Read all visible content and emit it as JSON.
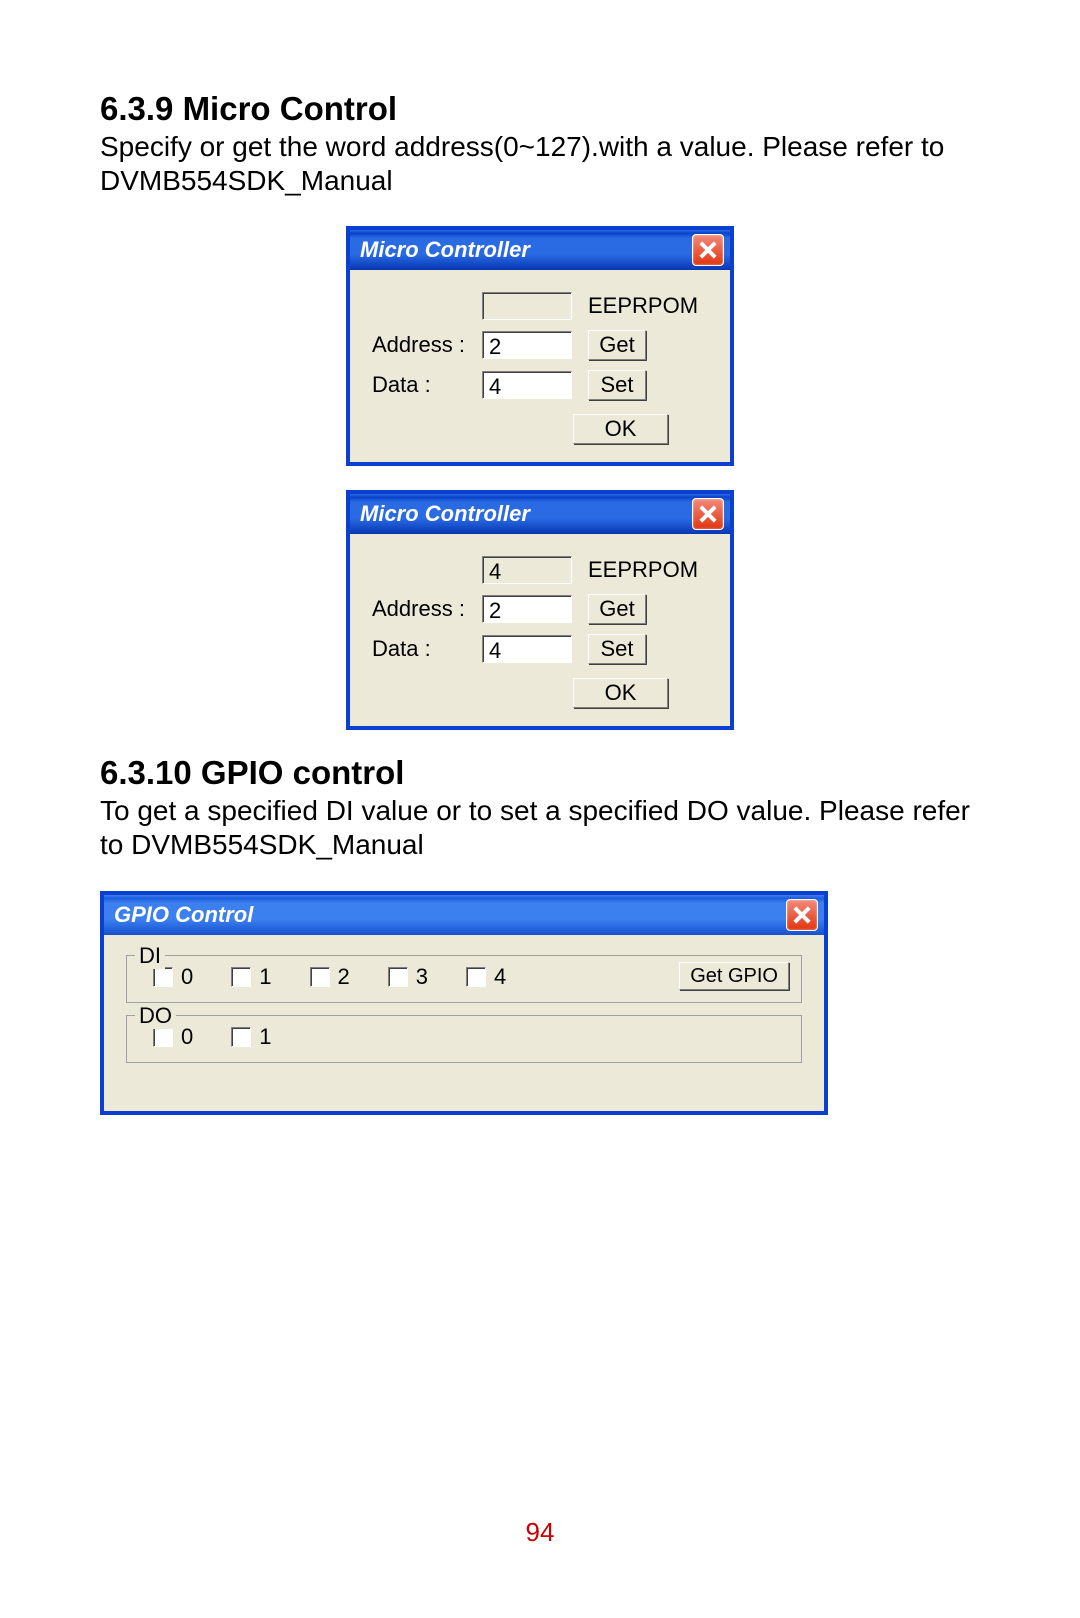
{
  "section1": {
    "heading": "6.3.9 Micro Control",
    "para": "Specify or get the word address(0~127).with a value. Please refer to DVMB554SDK_Manual"
  },
  "dialogA": {
    "title": "Micro Controller",
    "topvalue": "",
    "eeprom": "EEPRPOM",
    "addr_label": "Address :",
    "addr_value": "2",
    "get": "Get",
    "data_label": "Data :",
    "data_value": "4",
    "set": "Set",
    "ok": "OK"
  },
  "dialogB": {
    "title": "Micro Controller",
    "topvalue": "4",
    "eeprom": "EEPRPOM",
    "addr_label": "Address :",
    "addr_value": "2",
    "get": "Get",
    "data_label": "Data :",
    "data_value": "4",
    "set": "Set",
    "ok": "OK"
  },
  "section2": {
    "heading": "6.3.10 GPIO control",
    "para": "To get a specified DI value or to set a specified DO value. Please refer to DVMB554SDK_Manual"
  },
  "gpio": {
    "title": "GPIO Control",
    "di_legend": "DI",
    "di_items": [
      "0",
      "1",
      "2",
      "3",
      "4"
    ],
    "get_btn": "Get GPIO",
    "do_legend": "DO",
    "do_items": [
      "0",
      "1"
    ]
  },
  "pagenum": "94"
}
